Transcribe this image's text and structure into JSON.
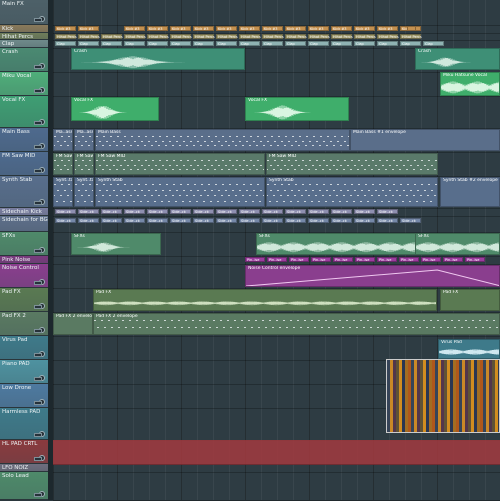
{
  "tracks": [
    {
      "name": "Main FX"
    },
    {
      "name": "Kick"
    },
    {
      "name": "Hihat Percs"
    },
    {
      "name": "Clap"
    },
    {
      "name": "Crash"
    },
    {
      "name": "Miku Vocal"
    },
    {
      "name": "Vocal FX"
    },
    {
      "name": "Main Bass"
    },
    {
      "name": "FM Saw MID"
    },
    {
      "name": "Synth Stab"
    },
    {
      "name": "Sidechain Kick"
    },
    {
      "name": "Sidechain for BGM"
    },
    {
      "name": "SFXs"
    },
    {
      "name": "Pink Noise"
    },
    {
      "name": "Noise Control"
    },
    {
      "name": "Pad FX"
    },
    {
      "name": "Pad FX 2"
    },
    {
      "name": "Virus Pad"
    },
    {
      "name": "Piano PAD"
    },
    {
      "name": "Low Drone"
    },
    {
      "name": "Harmless PAD"
    },
    {
      "name": "HL PAD CRTL"
    },
    {
      "name": "LFO NOIZ"
    },
    {
      "name": "Solo Lead"
    }
  ],
  "clips": {
    "kick": "Kick #3",
    "hihat": "Hihat Percs",
    "clap": "Clap",
    "crash": "Crash",
    "miku_vocal": "Miku Hatsune Vocal",
    "vocal_fx": "Vocal FX",
    "main_bass_a": "Ma..ass",
    "main_bass_b": "Main Bass",
    "main_bass_env": "Main Bass #1 envelope",
    "fm_saw": "FM Saw MID",
    "synth_stab_a": "Synt..tab",
    "synth_stab_b": "Synth Stab",
    "synth_stab_env": "Synth Stab #2 envelope",
    "side_kick": "Side..ck",
    "sfxs": "SFXs",
    "pink_noise": "Pin..ise",
    "noise_env": "Noise Control envelope",
    "pad_fx": "Pad FX",
    "pad_fx_2": "Pad FX #2",
    "pad_fx2_env": "Pad FX 2 envelope",
    "virus_pad": "Virus Pad"
  },
  "colors": {
    "header_bg": "#3a4a52",
    "green_clip": "#3fae6b",
    "blue_clip": "#5c78b0",
    "slate_clip": "#5a6e8a",
    "magenta_clip": "#9b3c9e",
    "red_lane": "#a33a40",
    "orange_kick": "#c49150"
  }
}
